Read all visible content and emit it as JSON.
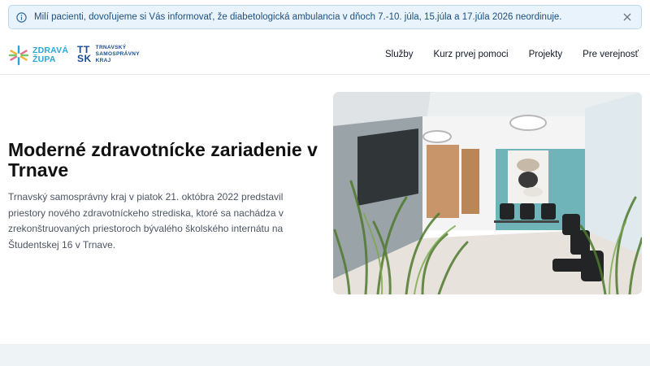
{
  "notice": {
    "text": "Milí pacienti, dovoľujeme si Vás informovať, že diabetologická ambulancia v dňoch 7.-10. júla, 15.júla a 17.júla 2026 neordinuje.",
    "icon": "info-icon",
    "close_icon": "close-icon",
    "colors": {
      "background": "#e9f3fb",
      "border": "#b9d8ee",
      "text": "#1d4f7d"
    }
  },
  "header": {
    "logo_zdrava": {
      "line1": "ZDRAVÁ",
      "line2": "ŽUPA"
    },
    "logo_ttsk": {
      "mark_top": "TT",
      "mark_bottom": "SK",
      "line1": "TRNAVSKÝ",
      "line2": "SAMOSPRÁVNY",
      "line3": "KRAJ"
    },
    "nav": [
      {
        "label": "Služby"
      },
      {
        "label": "Kurz prvej pomoci"
      },
      {
        "label": "Projekty"
      },
      {
        "label": "Pre verejnosť"
      }
    ]
  },
  "hero": {
    "title": "Moderné zdravotnícke zariadenie v Trnave",
    "description": "Trnavský samosprávny kraj v piatok 21. októbra 2022 predstavil priestory nového zdravotníckeho strediska, ktoré sa nachádza v zrekonštruovaných priestoroch bývalého školského internátu na Študentskej 16 v Trnave."
  },
  "colors": {
    "brand_blue": "#1a4c8b",
    "brand_cyan": "#2aa7d9",
    "footer_band": "#eef4f5"
  }
}
